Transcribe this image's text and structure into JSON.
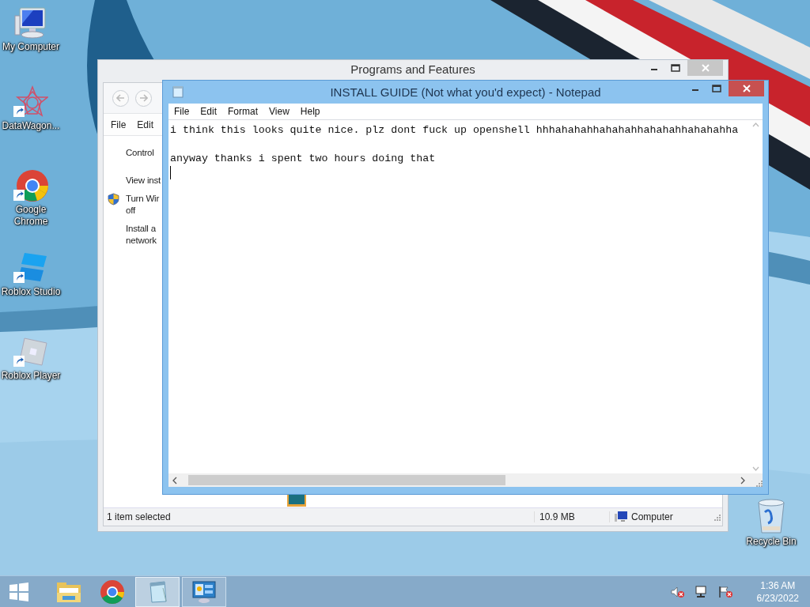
{
  "desktop_icons": [
    {
      "kind": "computer",
      "label": "My Computer",
      "shortcut": false
    },
    {
      "kind": "star",
      "label": "DataWagon...",
      "shortcut": true
    },
    {
      "kind": "chrome",
      "label": "Google Chrome",
      "shortcut": true
    },
    {
      "kind": "studio",
      "label": "Roblox Studio",
      "shortcut": true
    },
    {
      "kind": "player",
      "label": "Roblox Player",
      "shortcut": true
    }
  ],
  "recycle_bin": {
    "label": "Recycle Bin"
  },
  "programs_window": {
    "title": "Programs and Features",
    "menu": [
      "File",
      "Edit"
    ],
    "tasks": [
      {
        "lines": [
          "Control"
        ],
        "shield": false
      },
      {
        "lines": [
          "View inst"
        ],
        "shield": false
      },
      {
        "lines": [
          "Turn Wir",
          "off"
        ],
        "shield": true
      },
      {
        "lines": [
          "Install a",
          "network"
        ],
        "shield": false
      }
    ],
    "status_bar": {
      "selection": "1 item selected",
      "size": "10.9 MB",
      "location": "Computer"
    }
  },
  "notepad": {
    "title": "INSTALL GUIDE (Not what you'd expect) - Notepad",
    "menu": [
      "File",
      "Edit",
      "Format",
      "View",
      "Help"
    ],
    "text": "i think this looks quite nice. plz dont fuck up openshell hhhahahahhahahahhahahahhahahahha\n\nanyway thanks i spent two hours doing that"
  },
  "taskbar": {
    "items": [
      {
        "kind": "start",
        "selected": false,
        "open": false
      },
      {
        "kind": "folder",
        "selected": false,
        "open": false
      },
      {
        "kind": "chrome",
        "selected": false,
        "open": false
      },
      {
        "kind": "notepad",
        "selected": true,
        "open": true
      },
      {
        "kind": "control-panel",
        "selected": false,
        "open": true
      }
    ],
    "time": "1:36 AM",
    "date": "6/23/2022"
  }
}
